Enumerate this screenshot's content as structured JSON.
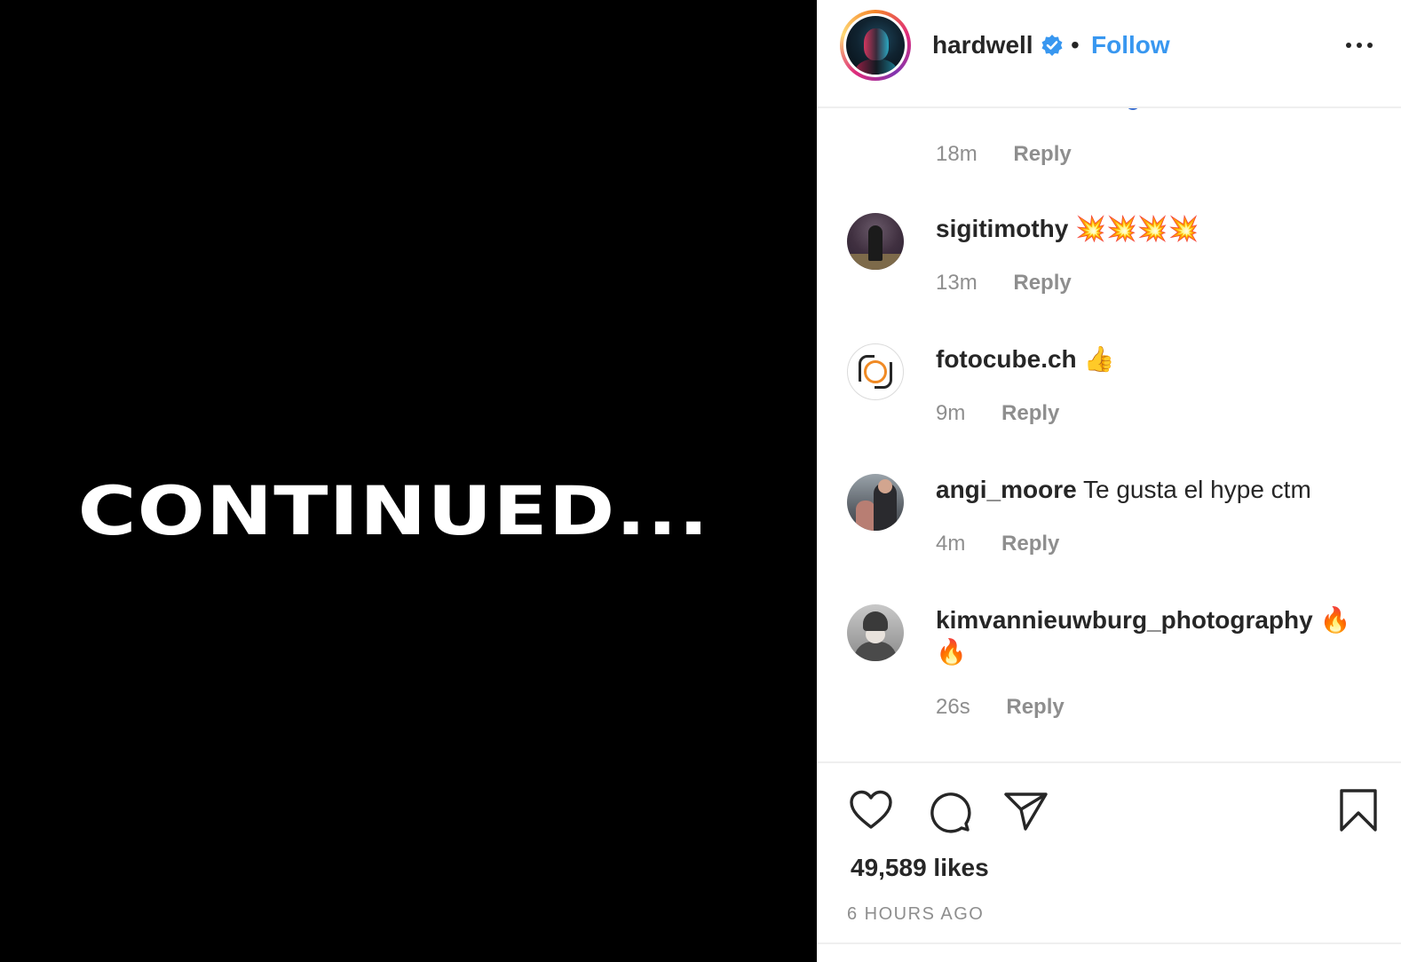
{
  "media": {
    "text": "CONTINUED...",
    "background": "#000000"
  },
  "header": {
    "username": "hardwell",
    "verified_icon": "verified-badge-icon",
    "separator": "•",
    "follow_label": "Follow",
    "more_icon": "more-options-icon",
    "accent": "#3897f0"
  },
  "comments": {
    "first_meta": {
      "time": "18m",
      "reply": "Reply"
    },
    "items": [
      {
        "user": "sigitimothy",
        "text": "💥💥💥💥",
        "time": "13m",
        "reply": "Reply"
      },
      {
        "user": "fotocube.ch",
        "text": "👍",
        "time": "9m",
        "reply": "Reply"
      },
      {
        "user": "angi_moore",
        "text": "Te gusta el hype ctm",
        "time": "4m",
        "reply": "Reply"
      },
      {
        "user": "kimvannieuwburg_photography",
        "text": "🔥🔥",
        "time": "26s",
        "reply": "Reply"
      }
    ]
  },
  "actions": {
    "icons": [
      "heart-icon",
      "comment-icon",
      "share-icon",
      "bookmark-icon"
    ],
    "likes": "49,589 likes",
    "timeago": "6 HOURS AGO"
  }
}
